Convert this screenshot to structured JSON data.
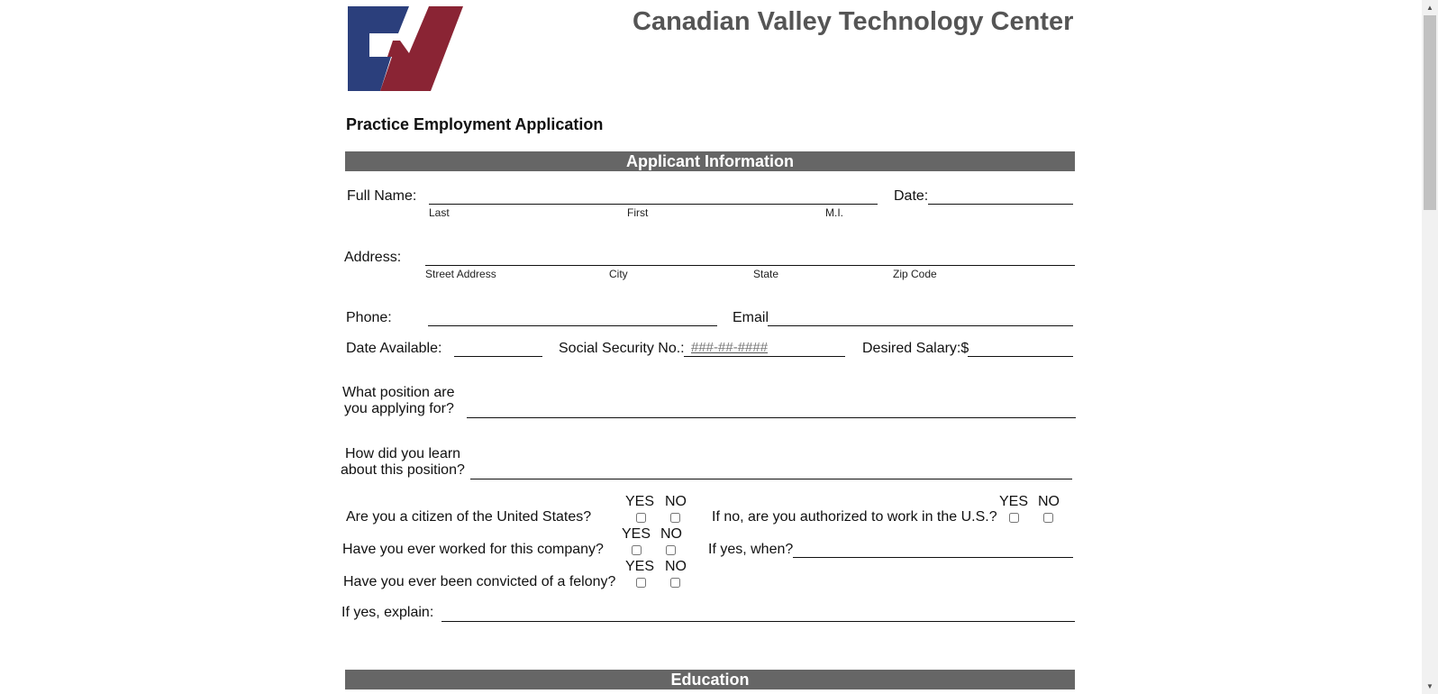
{
  "header": {
    "org_name": "Canadian Valley Technology Center",
    "form_title": "Practice Employment Application",
    "logo_colors": {
      "blue": "#2b3f7c",
      "red": "#8a2434"
    }
  },
  "sections": {
    "applicant_info": "Applicant Information",
    "education": "Education"
  },
  "full_name": {
    "label": "Full Name:",
    "sub_last": "Last",
    "sub_first": "First",
    "sub_mi": "M.I.",
    "date_label": "Date:"
  },
  "address": {
    "label": "Address:",
    "sub_street": "Street Address",
    "sub_city": "City",
    "sub_state": "State",
    "sub_zip": "Zip Code"
  },
  "contact": {
    "phone_label": "Phone:",
    "email_label": "Email"
  },
  "availability": {
    "date_available_label": "Date Available:",
    "ssn_label": "Social Security No.:",
    "ssn_placeholder": "###-##-####",
    "salary_label": "Desired Salary:$"
  },
  "position": {
    "label_line1": "What position are",
    "label_line2": "you applying for?"
  },
  "learn": {
    "label_line1": "How did you learn",
    "label_line2": "about this position?"
  },
  "questions": {
    "yes": "YES",
    "no": "NO",
    "citizen": "Are you a citizen of the United States?",
    "authorized": "If no, are you authorized to work in the U.S.?",
    "worked_here": "Have you ever worked for this company?",
    "if_yes_when": "If yes, when?",
    "felony": "Have you ever been convicted of a felony?",
    "if_yes_explain": "If yes, explain:"
  }
}
